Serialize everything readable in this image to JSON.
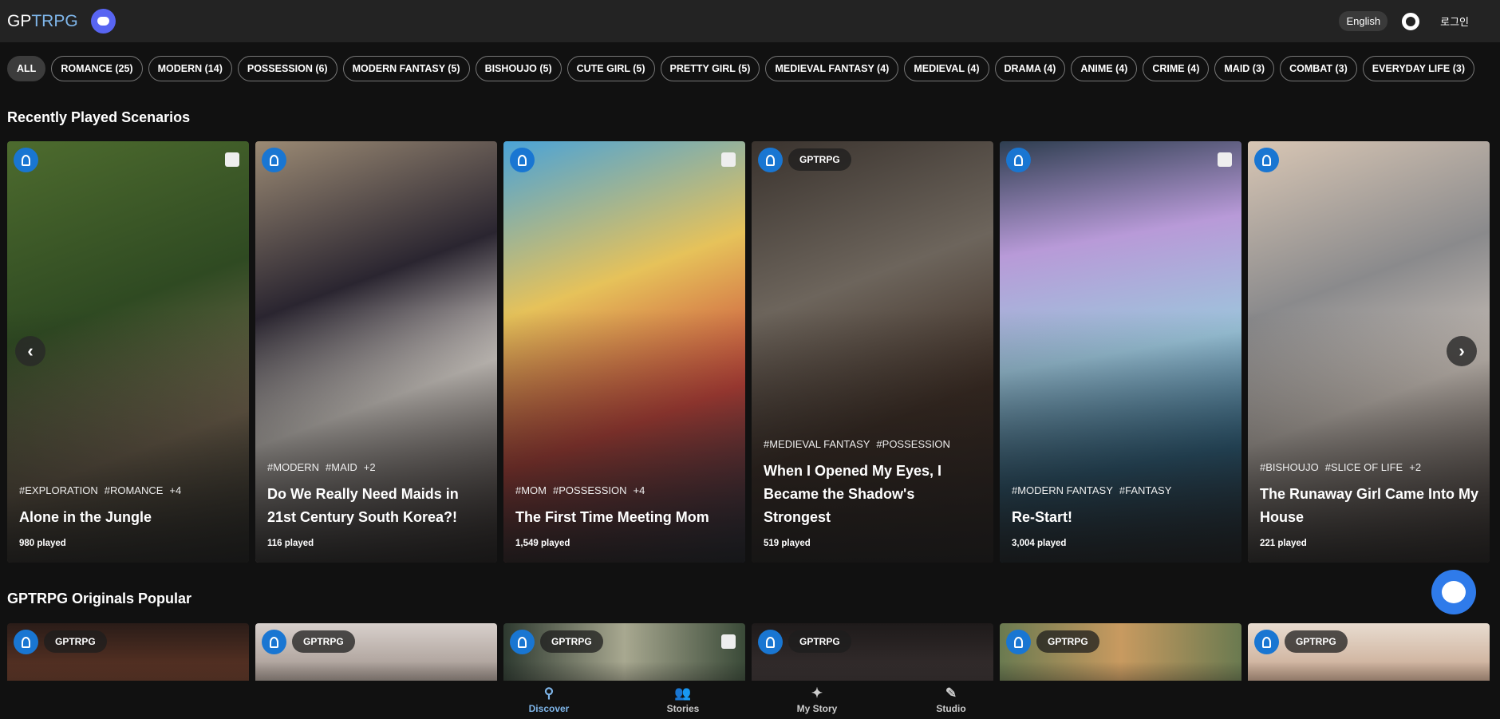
{
  "header": {
    "logo_a": "GP",
    "logo_b": "TRPG",
    "language": "English",
    "login": "로그인"
  },
  "chips": [
    "ALL",
    "ROMANCE (25)",
    "MODERN (14)",
    "POSSESSION (6)",
    "MODERN FANTASY (5)",
    "BISHOUJO (5)",
    "CUTE GIRL (5)",
    "PRETTY GIRL (5)",
    "MEDIEVAL FANTASY (4)",
    "MEDIEVAL (4)",
    "DRAMA (4)",
    "ANIME (4)",
    "CRIME (4)",
    "MAID (3)",
    "COMBAT (3)",
    "EVERYDAY LIFE (3)"
  ],
  "recent": {
    "title": "Recently Played Scenarios",
    "cards": [
      {
        "tags": [
          "#EXPLORATION",
          "#ROMANCE",
          "+4"
        ],
        "title": "Alone in the Jungle",
        "played": "980 played",
        "brand": "",
        "bg": "linear-gradient(160deg,#4d6b2e,#2f4a22 40%,#7a6a52 70%,#2a2a22)",
        "dice": true
      },
      {
        "tags": [
          "#MODERN",
          "#MAID",
          "+2"
        ],
        "title": "Do We Really Need Maids in 21st Century South Korea?!",
        "played": "116 played",
        "brand": "",
        "bg": "linear-gradient(160deg,#9b8a74,#2a2530 35%,#d8d2cc 60%,#3a2e2c)",
        "dice": false
      },
      {
        "tags": [
          "#MOM",
          "#POSSESSION",
          "+4"
        ],
        "title": "The First Time Meeting Mom",
        "played": "1,549 played",
        "brand": "",
        "bg": "linear-gradient(160deg,#4aa3d8,#e6c25a 35%,#c8443a 65%,#2b3550)",
        "dice": true
      },
      {
        "tags": [
          "#MEDIEVAL FANTASY",
          "#POSSESSION"
        ],
        "title": "When I Opened My Eyes, I Became the Shadow's Strongest",
        "played": "519 played",
        "brand": "GPTRPG",
        "bg": "linear-gradient(160deg,#3a332e,#6d655c 35%,#3b2b22 65%,#2c201c)",
        "dice": false
      },
      {
        "tags": [
          "#MODERN FANTASY",
          "#FANTASY"
        ],
        "title": "Re-Start!",
        "played": "3,004 played",
        "brand": "",
        "bg": "linear-gradient(170deg,#2e3e50,#b89ad8 25%,#9cc6dc 50%,#2f6a8c 75%,#1c2a36)",
        "dice": true
      },
      {
        "tags": [
          "#BISHOUJO",
          "#SLICE OF LIFE",
          "+2"
        ],
        "title": "The Runaway Girl Came Into My House",
        "played": "221 played",
        "brand": "",
        "bg": "linear-gradient(160deg,#d8c6b4,#8a8a8c 35%,#c9c0b8 60%,#4a3c36)",
        "dice": false
      }
    ]
  },
  "popular": {
    "title": "GPTRPG Originals Popular",
    "cards": [
      {
        "brand": "GPTRPG",
        "bg": "linear-gradient(#2a1c18,#8a4a30)",
        "dice": false
      },
      {
        "brand": "GPTRPG",
        "bg": "linear-gradient(#d8d0cc,#7a6a60)",
        "dice": false
      },
      {
        "brand": "GPTRPG",
        "bg": "linear-gradient(90deg,#2e3a30,#a8a890 50%,#3a4a38)",
        "dice": true
      },
      {
        "brand": "GPTRPG",
        "bg": "linear-gradient(#1e1a1a,#4a4040)",
        "dice": false
      },
      {
        "brand": "GPTRPG",
        "bg": "linear-gradient(90deg,#6a7a50,#c89a60 50%,#6a7a50)",
        "dice": false
      },
      {
        "brand": "GPTRPG",
        "bg": "linear-gradient(#e8dcd0,#b08060)",
        "dice": false
      }
    ]
  },
  "nav": [
    {
      "label": "Discover",
      "icon": "⚲"
    },
    {
      "label": "Stories",
      "icon": "👥"
    },
    {
      "label": "My Story",
      "icon": "✦"
    },
    {
      "label": "Studio",
      "icon": "✎"
    }
  ],
  "colors": {
    "accent": "#7fb6ea",
    "badge": "#1976d2",
    "discord": "#5865f2"
  }
}
